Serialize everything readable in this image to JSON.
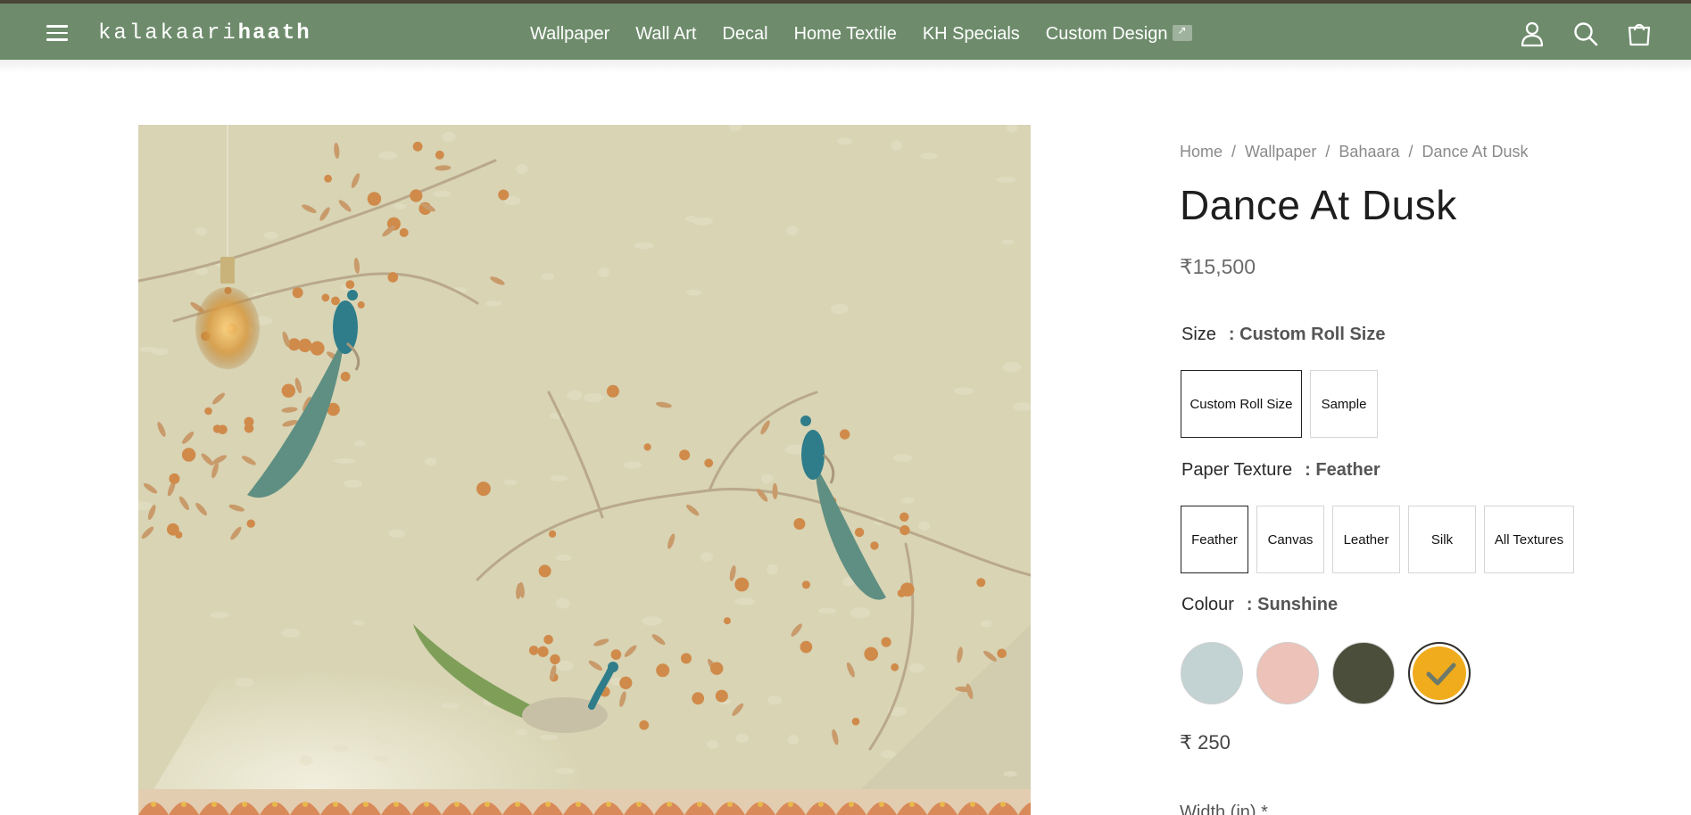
{
  "brand": {
    "logo_light": "kalakaari",
    "logo_bold": "haath"
  },
  "nav": {
    "items": [
      {
        "label": "Wallpaper"
      },
      {
        "label": "Wall Art"
      },
      {
        "label": "Decal"
      },
      {
        "label": "Home Textile"
      },
      {
        "label": "KH Specials"
      },
      {
        "label": "Custom Design"
      }
    ]
  },
  "header_icons": [
    "user-icon",
    "search-icon",
    "cart-icon"
  ],
  "breadcrumb": [
    "Home",
    "Wallpaper",
    "Bahaara",
    "Dance At Dusk"
  ],
  "product": {
    "title": "Dance At Dusk",
    "price": "₹15,500"
  },
  "size": {
    "label": "Size",
    "selected": ": Custom Roll Size",
    "options": [
      "Custom Roll Size",
      "Sample"
    ]
  },
  "texture": {
    "label": "Paper Texture",
    "selected": ": Feather",
    "options": [
      "Feather",
      "Canvas",
      "Leather",
      "Silk",
      "All Textures"
    ]
  },
  "colour": {
    "label": "Colour",
    "selected": ": Sunshine",
    "swatches": [
      "#c3d3d3",
      "#edc2b8",
      "#4a4e3a",
      "#f0ac1c"
    ],
    "selected_index": 3
  },
  "addon": {
    "price": "₹ 250"
  },
  "width": {
    "label": "Width (in) *"
  },
  "colors": {
    "header_bg": "#6e8c6c",
    "top_strip": "#4a4536",
    "wall": "#d8d4b4",
    "peacock_blue": "#2f7d8a",
    "peacock_green": "#6f8f4f",
    "flower": "#d08a4a"
  }
}
